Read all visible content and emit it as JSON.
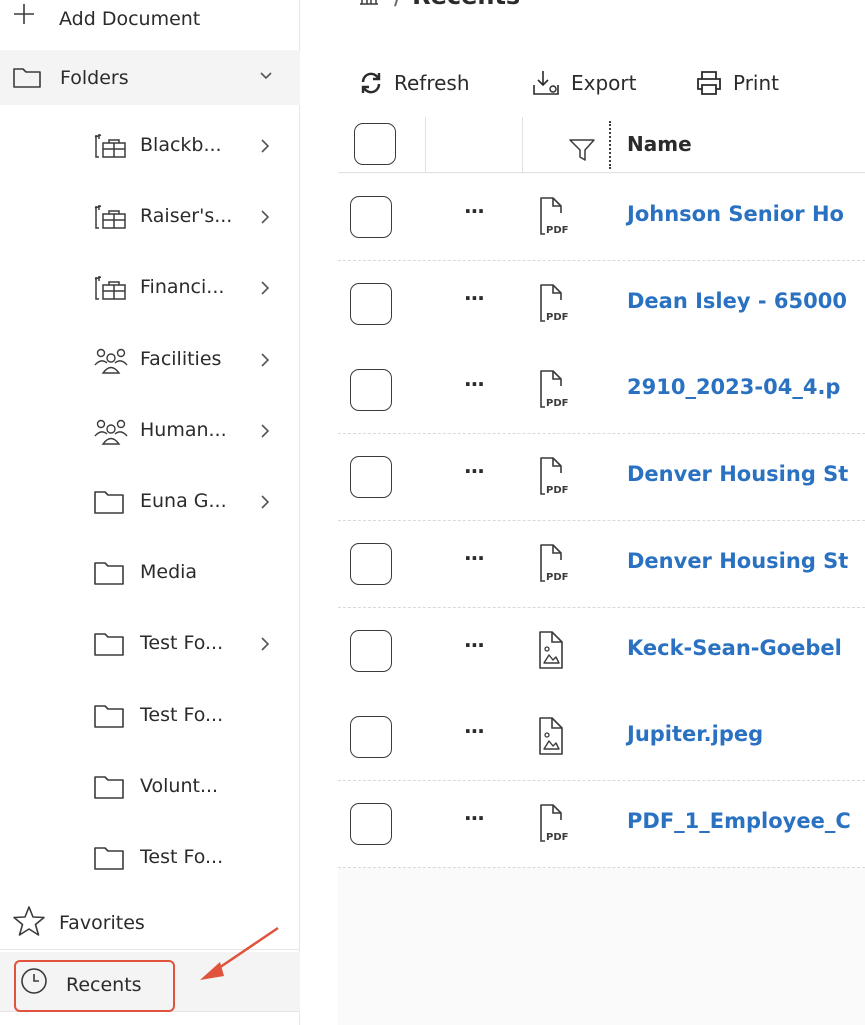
{
  "sidebar": {
    "add_document": "Add Document",
    "folders": "Folders",
    "items": [
      {
        "label": "Blackb...",
        "icon": "briefcase-folder-icon",
        "chevron": true
      },
      {
        "label": "Raiser's...",
        "icon": "briefcase-folder-icon",
        "chevron": true
      },
      {
        "label": "Financi...",
        "icon": "briefcase-folder-icon",
        "chevron": true
      },
      {
        "label": "Facilities",
        "icon": "group-icon",
        "chevron": true
      },
      {
        "label": "Human...",
        "icon": "group-icon",
        "chevron": true
      },
      {
        "label": "Euna G...",
        "icon": "folder-icon",
        "chevron": true
      },
      {
        "label": "Media",
        "icon": "folder-icon",
        "chevron": false
      },
      {
        "label": "Test Fo...",
        "icon": "folder-icon",
        "chevron": true
      },
      {
        "label": "Test Fo...",
        "icon": "folder-icon",
        "chevron": false
      },
      {
        "label": "Volunt...",
        "icon": "folder-icon",
        "chevron": false
      },
      {
        "label": "Test Fo...",
        "icon": "folder-icon",
        "chevron": false
      }
    ],
    "favorites": "Favorites",
    "recents": "Recents"
  },
  "breadcrumb": {
    "separator": "/",
    "current": "Recents"
  },
  "toolbar": {
    "refresh": "Refresh",
    "export": "Export",
    "print": "Print"
  },
  "grid": {
    "name_header": "Name",
    "rows": [
      {
        "name": "Johnson Senior Ho",
        "type": "pdf"
      },
      {
        "name": "Dean Isley - 65000",
        "type": "pdf"
      },
      {
        "name": "2910_2023-04_4.p",
        "type": "pdf"
      },
      {
        "name": "Denver Housing St",
        "type": "pdf"
      },
      {
        "name": "Denver Housing St",
        "type": "pdf"
      },
      {
        "name": "Keck-Sean-Goebel",
        "type": "image"
      },
      {
        "name": "Jupiter.jpeg",
        "type": "image"
      },
      {
        "name": "PDF_1_Employee_C",
        "type": "pdf"
      }
    ],
    "more_actions": "···"
  },
  "colors": {
    "link": "#2a72c1",
    "highlight": "#e0533d",
    "sidebar_active": "#f4f4f4"
  }
}
